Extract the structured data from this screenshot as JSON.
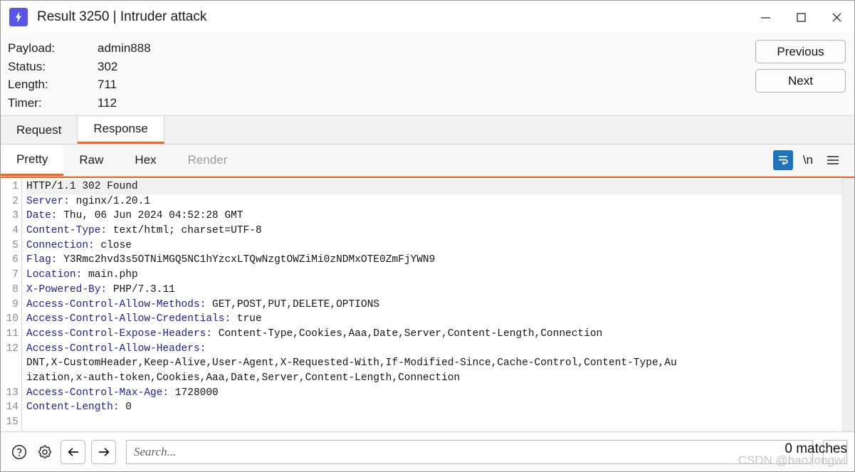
{
  "window": {
    "title": "Result 3250 | Intruder attack",
    "app_icon": "burp-lightning-icon",
    "accent_color": "#f26522",
    "icon_bg_color": "#5b54e8",
    "controls": {
      "minimize": "minimize-icon",
      "maximize": "maximize-icon",
      "close": "close-icon"
    }
  },
  "info": {
    "rows": [
      {
        "label": "Payload:",
        "value": "admin888"
      },
      {
        "label": "Status:",
        "value": "302"
      },
      {
        "label": "Length:",
        "value": "711"
      },
      {
        "label": "Timer:",
        "value": "112"
      }
    ],
    "previous_label": "Previous",
    "next_label": "Next"
  },
  "main_tabs": [
    {
      "label": "Request",
      "active": false
    },
    {
      "label": "Response",
      "active": true
    }
  ],
  "sub_tabs": [
    {
      "label": "Pretty",
      "active": true,
      "disabled": false
    },
    {
      "label": "Raw",
      "active": false,
      "disabled": false
    },
    {
      "label": "Hex",
      "active": false,
      "disabled": false
    },
    {
      "label": "Render",
      "active": false,
      "disabled": true
    }
  ],
  "sub_icons": {
    "wrap_icon": "word-wrap-icon",
    "wrap_active_color": "#1d74bc",
    "newline_label": "\\n",
    "menu_icon": "hamburger-menu-icon"
  },
  "editor": {
    "lines": [
      {
        "num": "1",
        "name": "",
        "value": "HTTP/1.1 302 Found"
      },
      {
        "num": "2",
        "name": "Server:",
        "value": "nginx/1.20.1"
      },
      {
        "num": "3",
        "name": "Date:",
        "value": "Thu, 06 Jun 2024 04:52:28 GMT"
      },
      {
        "num": "4",
        "name": "Content-Type:",
        "value": "text/html; charset=UTF-8"
      },
      {
        "num": "5",
        "name": "Connection:",
        "value": "close"
      },
      {
        "num": "6",
        "name": "Flag:",
        "value": "Y3Rmc2hvd3s5OTNiMGQ5NC1hYzcxLTQwNzgtOWZiMi0zNDMxOTE0ZmFjYWN9"
      },
      {
        "num": "7",
        "name": "Location:",
        "value": "main.php"
      },
      {
        "num": "8",
        "name": "X-Powered-By:",
        "value": "PHP/7.3.11"
      },
      {
        "num": "9",
        "name": "Access-Control-Allow-Methods:",
        "value": "GET,POST,PUT,DELETE,OPTIONS"
      },
      {
        "num": "10",
        "name": "Access-Control-Allow-Credentials:",
        "value": "true"
      },
      {
        "num": "11",
        "name": "Access-Control-Expose-Headers:",
        "value": "Content-Type,Cookies,Aaa,Date,Server,Content-Length,Connection"
      },
      {
        "num": "12",
        "name": "Access-Control-Allow-Headers:",
        "value": ""
      },
      {
        "num": "",
        "name": "",
        "value": "DNT,X-CustomHeader,Keep-Alive,User-Agent,X-Requested-With,If-Modified-Since,Cache-Control,Content-Type,Au"
      },
      {
        "num": "",
        "name": "",
        "value": "ization,x-auth-token,Cookies,Aaa,Date,Server,Content-Length,Connection"
      },
      {
        "num": "13",
        "name": "Access-Control-Max-Age:",
        "value": "1728000"
      },
      {
        "num": "14",
        "name": "Content-Length:",
        "value": "0"
      },
      {
        "num": "15",
        "name": "",
        "value": ""
      }
    ]
  },
  "bottom": {
    "help_icon": "help-circle-icon",
    "settings_icon": "gear-icon",
    "back_icon": "arrow-left-icon",
    "forward_icon": "arrow-right-icon",
    "search_placeholder": "Search...",
    "search_value": "",
    "matches_text": "0 matches",
    "watermark": "CSDN @baozongwi"
  }
}
